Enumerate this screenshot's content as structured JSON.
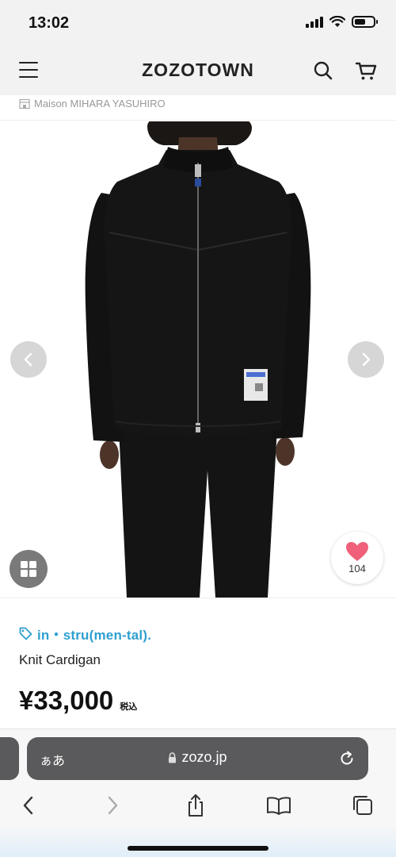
{
  "status_bar": {
    "time": "13:02"
  },
  "header": {
    "logo": "ZOZOTOWN",
    "icons": [
      "menu-icon",
      "search-icon",
      "cart-icon"
    ]
  },
  "breadcrumb": {
    "shop_label": "Maison MIHARA YASUHIRO",
    "icon": "store-icon"
  },
  "gallery": {
    "prev_icon": "chevron-left-icon",
    "next_icon": "chevron-right-icon",
    "grid_icon": "grid-icon",
    "like_count": "104"
  },
  "product": {
    "brand_tag": "in・stru(men-tal).",
    "name": "Knit Cardigan",
    "price": "¥33,000",
    "tax_label": "税込"
  },
  "browser": {
    "aa_label": "ぁあ",
    "url": "zozo.jp",
    "toolbar": [
      "back-icon",
      "forward-icon",
      "share-icon",
      "bookmarks-icon",
      "tabs-icon"
    ]
  },
  "colors": {
    "accent_tag": "#2e9fcf",
    "like_heart": "#f0607a",
    "header_bg": "#f2f2f2",
    "url_pill": "#5a5a5c"
  }
}
